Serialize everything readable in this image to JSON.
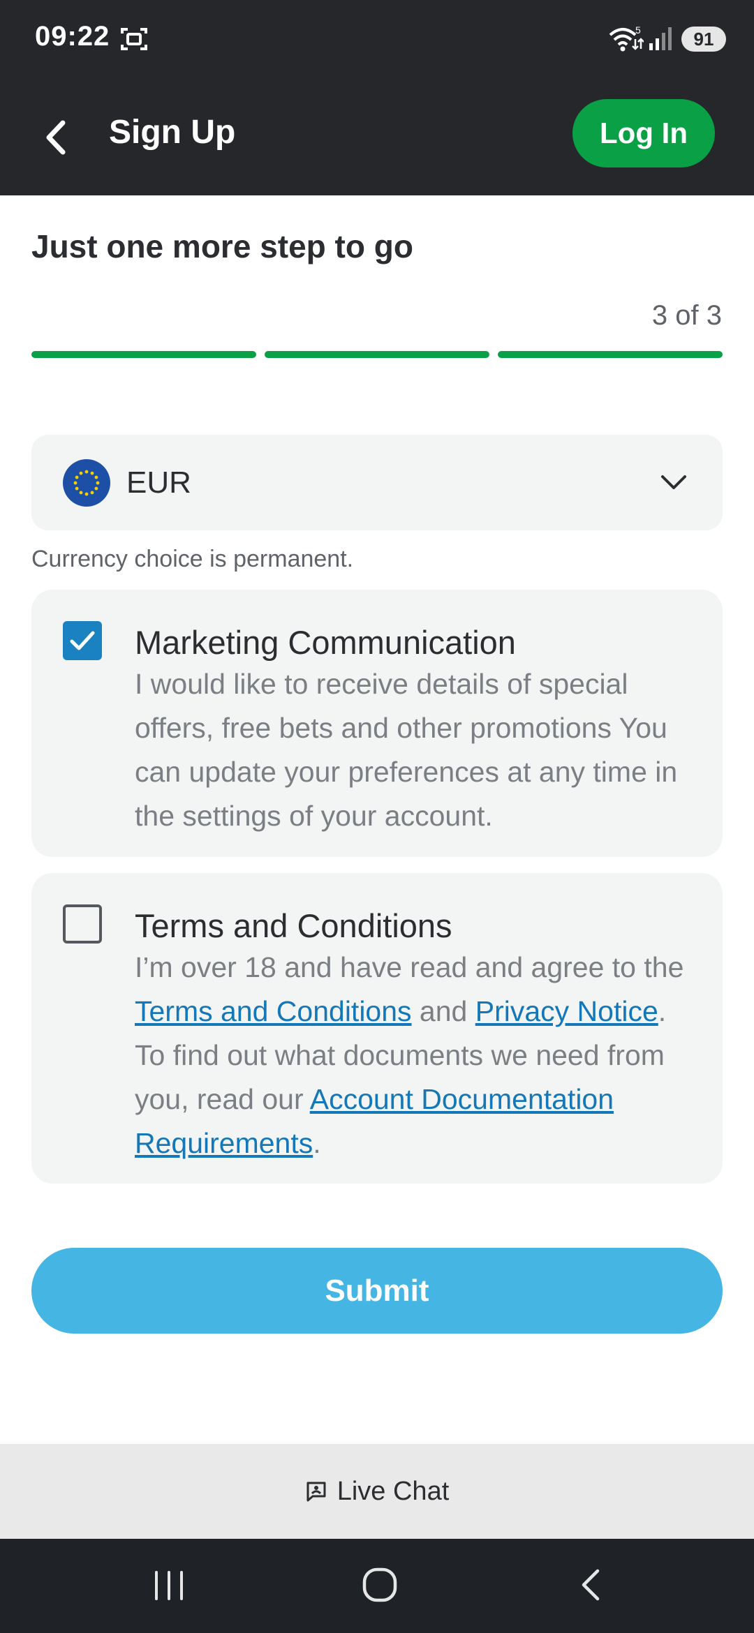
{
  "status_bar": {
    "time": "09:22",
    "wifi_badge": "5",
    "battery": "91"
  },
  "header": {
    "title": "Sign Up",
    "login_label": "Log In"
  },
  "step": {
    "title": "Just one more step to go",
    "counter": "3 of 3",
    "progress_completed": 3,
    "progress_total": 3
  },
  "currency": {
    "value": "EUR",
    "note": "Currency choice is permanent."
  },
  "marketing": {
    "title": "Marketing Communication",
    "checked": true,
    "body": "I would like to receive details of special offers, free bets and other promotions You can update your preferences at any time in the settings of your account."
  },
  "terms": {
    "title": "Terms and Conditions",
    "checked": false,
    "text_1": "I’m over 18 and have read and agree to the ",
    "link_terms": "Terms and Conditions",
    "text_2": " and ",
    "link_privacy": "Privacy Notice",
    "text_3": ". To find out what documents we need from you, read our ",
    "link_docs": "Account Documentation Requirements",
    "text_4": "."
  },
  "submit_label": "Submit",
  "live_chat_label": "Live Chat",
  "colors": {
    "brand_green": "#0aa046",
    "checkbox_blue": "#1a82c0",
    "submit_blue": "#45b5e3",
    "link_blue": "#1477b8",
    "dark_bg": "#25272a"
  },
  "icons": {
    "screenshot": "screenshot-icon",
    "wifi": "wifi-icon",
    "signal": "signal-icon",
    "back": "back-arrow-icon",
    "flag": "eu-flag-icon",
    "chevron": "chevron-down-icon",
    "check": "checkmark-icon",
    "chat": "chat-icon"
  }
}
